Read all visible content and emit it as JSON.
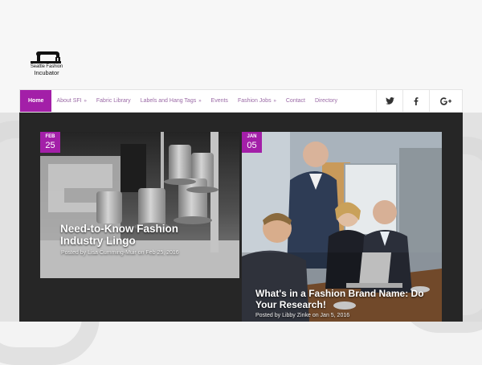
{
  "logo": {
    "line1": "Seattle Fashion",
    "line2": "Incubator"
  },
  "nav": {
    "items": [
      {
        "label": "Home",
        "active": true
      },
      {
        "label": "About SFI",
        "caret": "»"
      },
      {
        "label": "Fabric Library"
      },
      {
        "label": "Labels and Hang Tags",
        "caret": "»"
      },
      {
        "label": "Events"
      },
      {
        "label": "Fashion Jobs",
        "caret": "»"
      },
      {
        "label": "Contact"
      },
      {
        "label": "Directory"
      }
    ],
    "social": [
      {
        "icon": "twitter-icon",
        "glyph": "t"
      },
      {
        "icon": "facebook-icon",
        "glyph": "f"
      },
      {
        "icon": "google-plus-icon",
        "glyph": "g+"
      }
    ]
  },
  "posts": [
    {
      "month": "FEB",
      "day": "25",
      "title": "Need-to-Know Fashion Industry Lingo",
      "meta": "Posted by Lisa Cumming-Muir on Feb 25, 2016"
    },
    {
      "month": "JAN",
      "day": "05",
      "title": "What's in a Fashion Brand Name: Do Your Research!",
      "meta": "Posted by Libby Zinke on Jan 5, 2016"
    }
  ],
  "colors": {
    "accent": "#a31fa8",
    "nav_link": "#9b6aa6",
    "content_bg": "#262626"
  }
}
